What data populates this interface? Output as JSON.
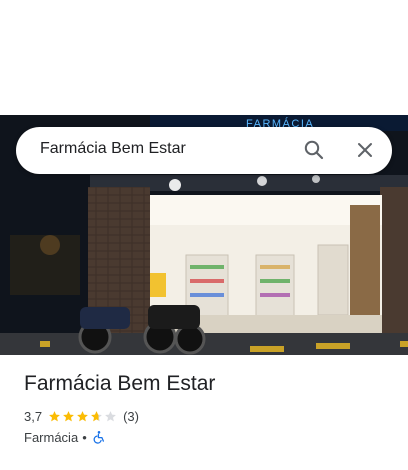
{
  "search": {
    "query": "Farmácia Bem Estar"
  },
  "photo": {
    "sign_text": "FARMÁCIA"
  },
  "place": {
    "name": "Farmácia Bem Estar",
    "rating": "3,7",
    "rating_value": 3.7,
    "review_count": "(3)",
    "category": "Farmácia",
    "separator": "•",
    "accessibility_icon": "wheelchair-icon"
  },
  "colors": {
    "star": "#fbbc04",
    "star_empty": "#dadce0",
    "accessibility": "#1a73e8",
    "sign": "#5ab8ff"
  }
}
